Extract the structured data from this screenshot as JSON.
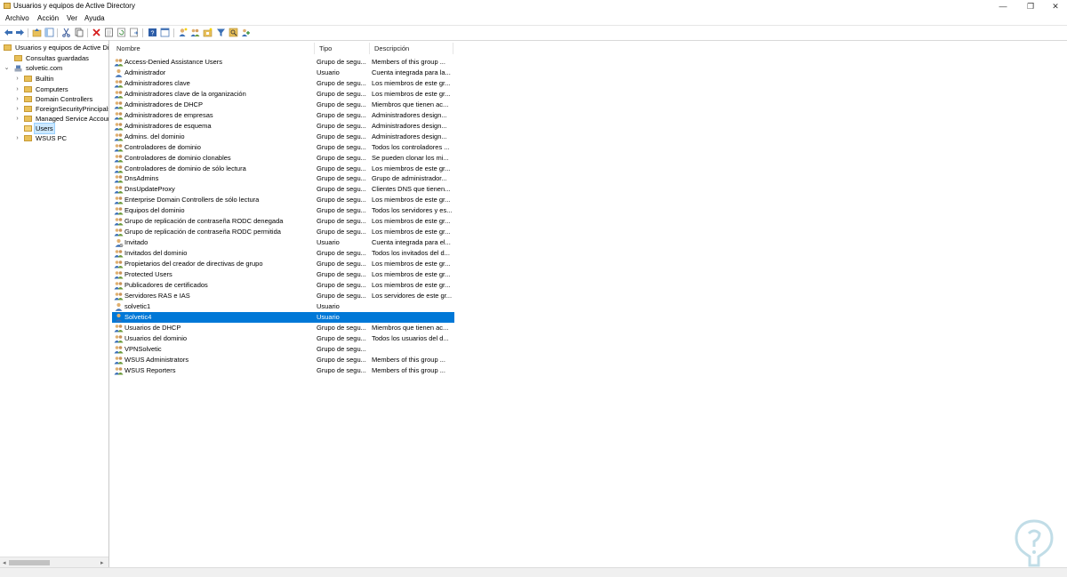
{
  "window": {
    "title": "Usuarios y equipos de Active Directory",
    "controls": {
      "minimize": "—",
      "restore": "❐",
      "close": "✕"
    }
  },
  "menu": [
    "Archivo",
    "Acción",
    "Ver",
    "Ayuda"
  ],
  "toolbar": {
    "icons": [
      "back-arrow-icon",
      "forward-arrow-icon",
      "up-folder-icon",
      "show-tree-icon",
      "cut-icon",
      "copy-icon",
      "delete-icon",
      "properties-icon",
      "refresh-icon",
      "export-list-icon",
      "help-icon",
      "console-icon",
      "create-user-icon",
      "create-group-icon",
      "create-ou-icon",
      "filter-icon",
      "find-icon",
      "add-to-group-icon"
    ]
  },
  "tree": {
    "root": "Usuarios y equipos de Active Directory",
    "saved_queries": "Consultas guardadas",
    "domain": "solvetic.com",
    "children": [
      "Builtin",
      "Computers",
      "Domain Controllers",
      "ForeignSecurityPrincipals",
      "Managed Service Accounts",
      "Users",
      "WSUS PC"
    ],
    "selected": "Users"
  },
  "columns": {
    "name": "Nombre",
    "type": "Tipo",
    "desc": "Descripción"
  },
  "rows": [
    {
      "name": "Access-Denied Assistance Users",
      "type": "Grupo de segu...",
      "desc": "Members of this group ...",
      "kind": "group"
    },
    {
      "name": "Administrador",
      "type": "Usuario",
      "desc": "Cuenta integrada para la...",
      "kind": "user"
    },
    {
      "name": "Administradores clave",
      "type": "Grupo de segu...",
      "desc": "Los miembros de este gr...",
      "kind": "group"
    },
    {
      "name": "Administradores clave de la organización",
      "type": "Grupo de segu...",
      "desc": "Los miembros de este gr...",
      "kind": "group"
    },
    {
      "name": "Administradores de DHCP",
      "type": "Grupo de segu...",
      "desc": "Miembros que tienen ac...",
      "kind": "group"
    },
    {
      "name": "Administradores de empresas",
      "type": "Grupo de segu...",
      "desc": "Administradores design...",
      "kind": "group"
    },
    {
      "name": "Administradores de esquema",
      "type": "Grupo de segu...",
      "desc": "Administradores design...",
      "kind": "group"
    },
    {
      "name": "Admins. del dominio",
      "type": "Grupo de segu...",
      "desc": "Administradores design...",
      "kind": "group"
    },
    {
      "name": "Controladores de dominio",
      "type": "Grupo de segu...",
      "desc": "Todos los controladores ...",
      "kind": "group"
    },
    {
      "name": "Controladores de dominio clonables",
      "type": "Grupo de segu...",
      "desc": "Se pueden clonar los mi...",
      "kind": "group"
    },
    {
      "name": "Controladores de dominio de sólo lectura",
      "type": "Grupo de segu...",
      "desc": "Los miembros de este gr...",
      "kind": "group"
    },
    {
      "name": "DnsAdmins",
      "type": "Grupo de segu...",
      "desc": "Grupo de administrador...",
      "kind": "group"
    },
    {
      "name": "DnsUpdateProxy",
      "type": "Grupo de segu...",
      "desc": "Clientes DNS que tienen...",
      "kind": "group"
    },
    {
      "name": "Enterprise Domain Controllers de sólo lectura",
      "type": "Grupo de segu...",
      "desc": "Los miembros de este gr...",
      "kind": "group"
    },
    {
      "name": "Equipos del dominio",
      "type": "Grupo de segu...",
      "desc": "Todos los servidores y es...",
      "kind": "group"
    },
    {
      "name": "Grupo de replicación de contraseña RODC denegada",
      "type": "Grupo de segu...",
      "desc": "Los miembros de este gr...",
      "kind": "group"
    },
    {
      "name": "Grupo de replicación de contraseña RODC permitida",
      "type": "Grupo de segu...",
      "desc": "Los miembros de este gr...",
      "kind": "group"
    },
    {
      "name": "Invitado",
      "type": "Usuario",
      "desc": "Cuenta integrada para el...",
      "kind": "user-disabled"
    },
    {
      "name": "Invitados del dominio",
      "type": "Grupo de segu...",
      "desc": "Todos los invitados del d...",
      "kind": "group"
    },
    {
      "name": "Propietarios del creador de directivas de grupo",
      "type": "Grupo de segu...",
      "desc": "Los miembros de este gr...",
      "kind": "group"
    },
    {
      "name": "Protected Users",
      "type": "Grupo de segu...",
      "desc": "Los miembros de este gr...",
      "kind": "group"
    },
    {
      "name": "Publicadores de certificados",
      "type": "Grupo de segu...",
      "desc": "Los miembros de este gr...",
      "kind": "group"
    },
    {
      "name": "Servidores RAS e IAS",
      "type": "Grupo de segu...",
      "desc": "Los servidores de este gr...",
      "kind": "group"
    },
    {
      "name": "solvetic1",
      "type": "Usuario",
      "desc": "",
      "kind": "user"
    },
    {
      "name": "Solvetic4",
      "type": "Usuario",
      "desc": "",
      "kind": "user",
      "selected": true
    },
    {
      "name": "Usuarios de DHCP",
      "type": "Grupo de segu...",
      "desc": "Miembros que tienen ac...",
      "kind": "group"
    },
    {
      "name": "Usuarios del dominio",
      "type": "Grupo de segu...",
      "desc": "Todos los usuarios del d...",
      "kind": "group"
    },
    {
      "name": "VPNSolvetic",
      "type": "Grupo de segu...",
      "desc": "",
      "kind": "group"
    },
    {
      "name": "WSUS Administrators",
      "type": "Grupo de segu...",
      "desc": "Members of this group ...",
      "kind": "group"
    },
    {
      "name": "WSUS Reporters",
      "type": "Grupo de segu...",
      "desc": "Members of this group ...",
      "kind": "group"
    }
  ],
  "colors": {
    "selection": "#0078d7",
    "folder": "#e8c05a",
    "watermark": "#8fc3d4"
  }
}
